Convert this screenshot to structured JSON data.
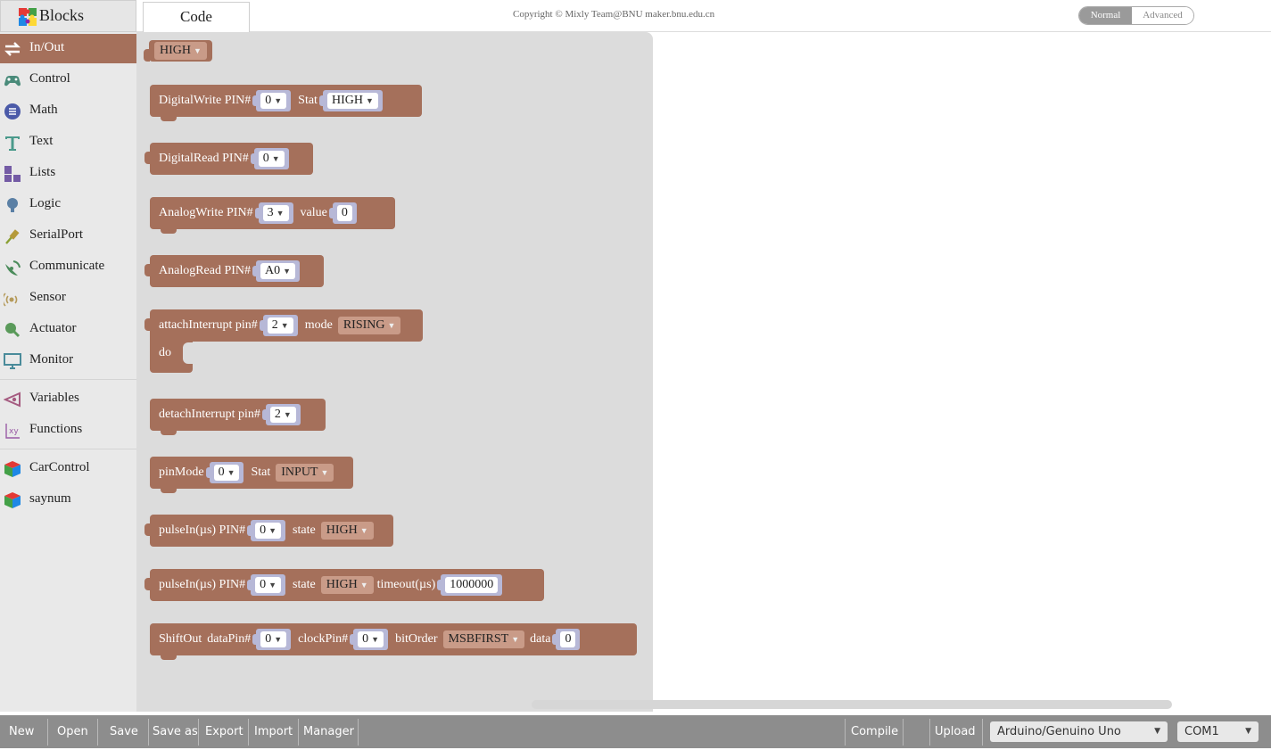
{
  "header": {
    "blocks_tab": "Blocks",
    "code_tab": "Code",
    "copyright": "Copyright © Mixly Team@BNU maker.bnu.edu.cn",
    "mode_normal": "Normal",
    "mode_advanced": "Advanced"
  },
  "sidebar": {
    "categories": [
      {
        "label": "In/Out",
        "icon": "arrows-icon",
        "selected": true
      },
      {
        "label": "Control",
        "icon": "gamepad-icon"
      },
      {
        "label": "Math",
        "icon": "math-icon"
      },
      {
        "label": "Text",
        "icon": "text-icon"
      },
      {
        "label": "Lists",
        "icon": "lists-icon"
      },
      {
        "label": "Logic",
        "icon": "bulb-icon"
      },
      {
        "label": "SerialPort",
        "icon": "usb-plug-icon"
      },
      {
        "label": "Communicate",
        "icon": "satellite-icon"
      },
      {
        "label": "Sensor",
        "icon": "sensor-icon"
      },
      {
        "label": "Actuator",
        "icon": "actuator-icon"
      },
      {
        "label": "Monitor",
        "icon": "monitor-icon"
      },
      {
        "label": "Variables",
        "icon": "variables-icon"
      },
      {
        "label": "Functions",
        "icon": "functions-icon"
      },
      {
        "label": "CarControl",
        "icon": "cube-icon"
      },
      {
        "label": "saynum",
        "icon": "cube-icon"
      }
    ]
  },
  "blocks": {
    "high": {
      "value": "HIGH"
    },
    "digitalwrite": {
      "label": "DigitalWrite PIN#",
      "pin": "0",
      "stat_label": "Stat",
      "stat": "HIGH"
    },
    "digitalread": {
      "label": "DigitalRead PIN#",
      "pin": "0"
    },
    "analogwrite": {
      "label": "AnalogWrite PIN#",
      "pin": "3",
      "value_label": "value",
      "value": "0"
    },
    "analogread": {
      "label": "AnalogRead PIN#",
      "pin": "A0"
    },
    "attachinterrupt": {
      "label": "attachInterrupt pin#",
      "pin": "2",
      "mode_label": "mode",
      "mode": "RISING",
      "do_label": "do"
    },
    "detachinterrupt": {
      "label": "detachInterrupt pin#",
      "pin": "2"
    },
    "pinmode": {
      "label": "pinMode",
      "pin": "0",
      "stat_label": "Stat",
      "stat": "INPUT"
    },
    "pulsein": {
      "label": "pulseIn(µs) PIN#",
      "pin": "0",
      "state_label": "state",
      "state": "HIGH"
    },
    "pulsein_timeout": {
      "label": "pulseIn(µs) PIN#",
      "pin": "0",
      "state_label": "state",
      "state": "HIGH",
      "timeout_label": "timeout(µs)",
      "timeout": "1000000"
    },
    "shiftout": {
      "label": "ShiftOut",
      "datapin_label": "dataPin#",
      "datapin": "0",
      "clockpin_label": "clockPin#",
      "clockpin": "0",
      "bitorder_label": "bitOrder",
      "bitorder": "MSBFIRST",
      "data_label": "data",
      "data": "0"
    }
  },
  "bottombar": {
    "new": "New",
    "open": "Open",
    "save": "Save",
    "save_as": "Save as",
    "export": "Export",
    "import": "Import",
    "manager": "Manager",
    "compile": "Compile",
    "upload": "Upload",
    "board": "Arduino/Genuino Uno",
    "port": "COM1"
  },
  "colors": {
    "block": "#a5705b",
    "socket": "#b7b8d7",
    "flyout": "#dcdcdc",
    "bottombar": "#8d8d8d"
  }
}
